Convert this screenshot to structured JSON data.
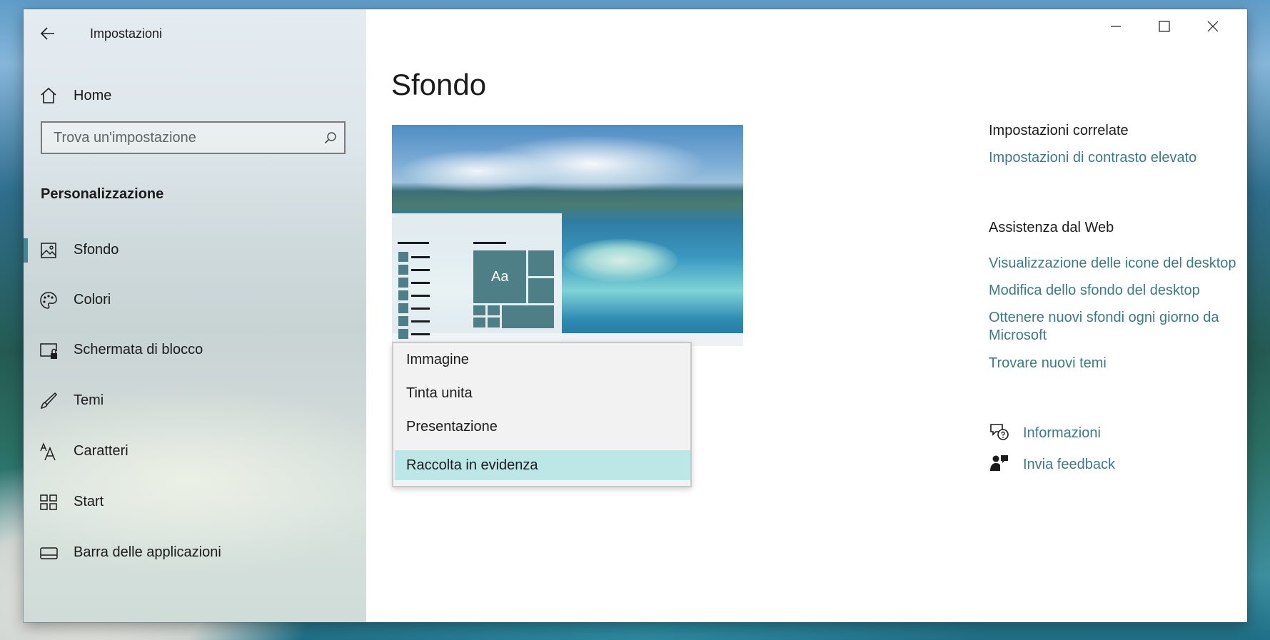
{
  "window": {
    "title": "Impostazioni",
    "controls": {
      "minimize": "minimize-icon",
      "maximize": "maximize-icon",
      "close": "close-icon"
    }
  },
  "sidebar": {
    "home_label": "Home",
    "search_placeholder": "Trova un'impostazione",
    "section_title": "Personalizzazione",
    "items": [
      {
        "label": "Sfondo",
        "icon": "image-icon",
        "selected": true
      },
      {
        "label": "Colori",
        "icon": "palette-icon"
      },
      {
        "label": "Schermata di blocco",
        "icon": "lock-screen-icon"
      },
      {
        "label": "Temi",
        "icon": "brush-icon"
      },
      {
        "label": "Caratteri",
        "icon": "font-icon"
      },
      {
        "label": "Start",
        "icon": "start-grid-icon"
      },
      {
        "label": "Barra delle applicazioni",
        "icon": "taskbar-icon"
      }
    ]
  },
  "main": {
    "title": "Sfondo",
    "preview_tile_text": "Aa",
    "background_dropdown": {
      "options": [
        "Immagine",
        "Tinta unita",
        "Presentazione",
        "Raccolta in evidenza"
      ],
      "selected": "Raccolta in evidenza"
    }
  },
  "related": {
    "heading": "Impostazioni correlate",
    "links": [
      "Impostazioni di contrasto elevato"
    ]
  },
  "web_help": {
    "heading": "Assistenza dal Web",
    "links": [
      "Visualizzazione delle icone del desktop",
      "Modifica dello sfondo del desktop",
      "Ottenere nuovi sfondi ogni giorno da Microsoft",
      "Trovare nuovi temi"
    ]
  },
  "footer_links": {
    "info": "Informazioni",
    "feedback": "Invia feedback"
  },
  "colors": {
    "accent": "#4a8490",
    "link": "#3c7a86",
    "selected_option": "#bde6e6",
    "tile": "#4e7f86"
  }
}
